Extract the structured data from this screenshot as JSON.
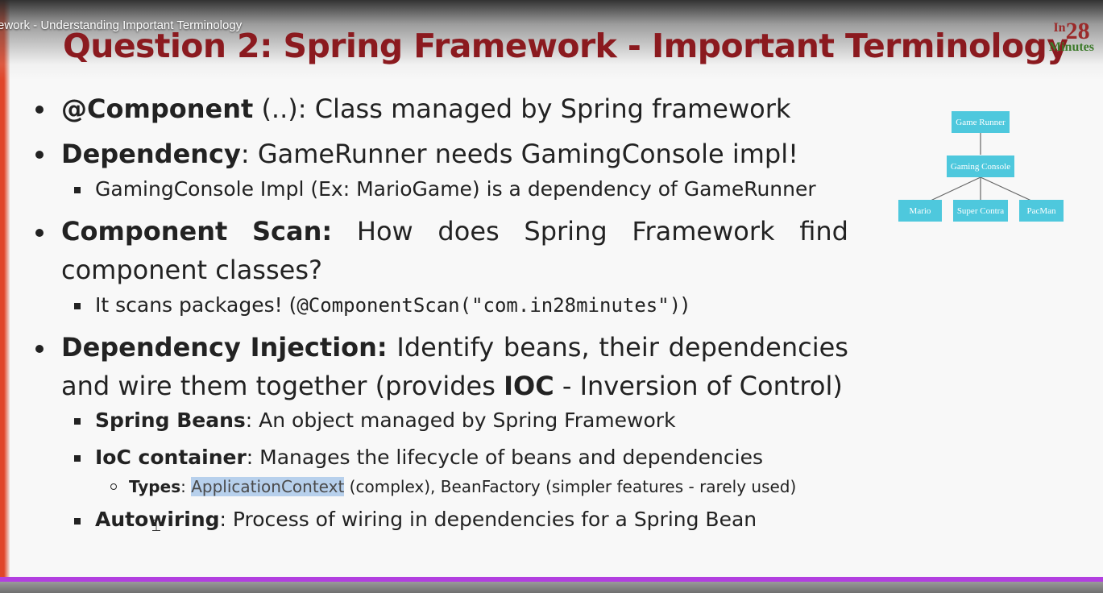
{
  "video": {
    "title": "ework - Understanding Important Terminology"
  },
  "slide": {
    "title": "Question 2: Spring Framework - Important Terminology",
    "logo": {
      "in": "In",
      "num": "28",
      "minutes": "Minutes"
    },
    "bullets": {
      "component": {
        "bold": "@Component",
        "rest": " (..): Class managed by Spring framework"
      },
      "dependency": {
        "bold": "Dependency",
        "rest": ": GameRunner needs GamingConsole impl!",
        "sub": "GamingConsole Impl (Ex: MarioGame) is a dependency of GameRunner"
      },
      "scan": {
        "w1": "Component",
        "w2": "Scan:",
        "w3": "How",
        "w4": "does",
        "w5": "Spring",
        "w6": "Framework",
        "w7": "find",
        "line2": "component classes?",
        "sub_prefix": "It scans packages! (",
        "sub_code": "@ComponentScan(\"com.in28minutes\")",
        "sub_suffix": ")"
      },
      "injection": {
        "w1": "Dependency",
        "w2": "Injection:",
        "w3": "Identify",
        "w4": "beans,",
        "w5": "their",
        "w6": "dependencies",
        "line2_a": "and wire them together (provides ",
        "line2_b": "IOC",
        "line2_c": " - Inversion of Control)",
        "beans_bold": "Spring Beans",
        "beans_rest": ": An object managed by Spring Framework",
        "ioc_bold": "IoC container",
        "ioc_rest": ": Manages the lifecycle of beans and dependencies",
        "types_bold": "Types",
        "types_colon": ": ",
        "types_hl": "ApplicationContext",
        "types_rest": " (complex), BeanFactory (simpler features - rarely used)",
        "auto_bold": "Autowiring",
        "auto_rest": ": Process of wiring in dependencies for a Spring Bean"
      }
    },
    "diagram": {
      "root": "Game Runner",
      "middle": "Gaming Console",
      "leaves": [
        "Mario",
        "Super Contra",
        "PacMan"
      ]
    }
  },
  "colors": {
    "title": "#8b1a1f",
    "node": "#4ec8dd",
    "progress": "#b23fe0",
    "highlight": "#b7d0ec"
  }
}
